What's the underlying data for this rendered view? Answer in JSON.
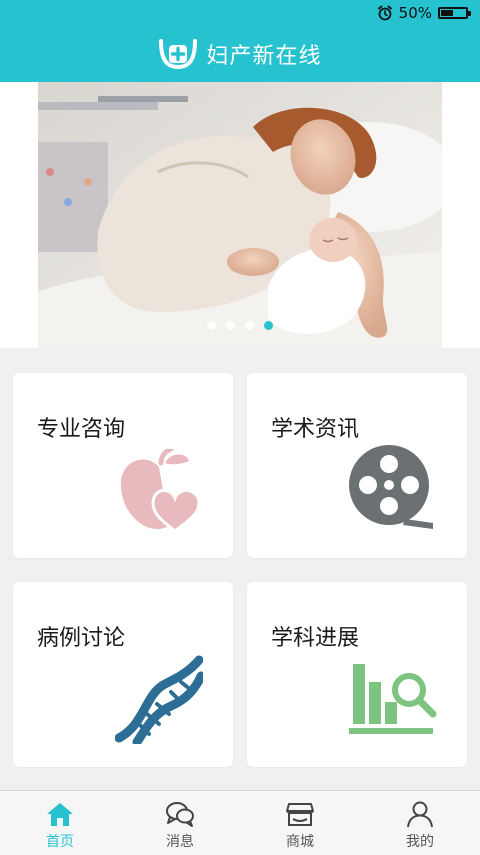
{
  "status_bar": {
    "battery_text": "50%",
    "battery_level": 0.5
  },
  "header": {
    "title": "妇产新在线",
    "logo_icon": "uterus-plus-logo"
  },
  "banner": {
    "image_name": "mother-and-newborn-photo",
    "dot_count": 4,
    "active_dot": 3
  },
  "cards": [
    {
      "title": "专业咨询",
      "icon": "apple-heart-icon",
      "icon_color": "#e8b9bd"
    },
    {
      "title": "学术资讯",
      "icon": "film-reel-icon",
      "icon_color": "#6b7072"
    },
    {
      "title": "病例讨论",
      "icon": "dna-icon",
      "icon_color": "#2d6e96"
    },
    {
      "title": "学科进展",
      "icon": "bar-chart-search-icon",
      "icon_color": "#7cc47f"
    }
  ],
  "tabs": [
    {
      "label": "首页",
      "icon": "home-icon",
      "active": true
    },
    {
      "label": "消息",
      "icon": "chat-bubbles-icon",
      "active": false
    },
    {
      "label": "商城",
      "icon": "shop-icon",
      "active": false
    },
    {
      "label": "我的",
      "icon": "user-icon",
      "active": false
    }
  ],
  "colors": {
    "accent": "#27c2cf",
    "background": "#f0f0f0",
    "card": "#ffffff",
    "text": "#1a1a1a"
  }
}
